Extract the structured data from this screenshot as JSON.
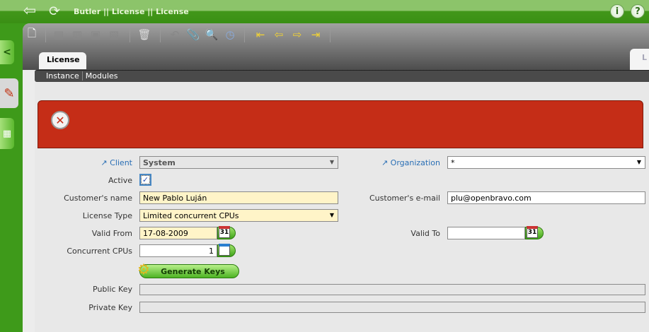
{
  "header": {
    "title": "Butler || License  ||  License",
    "back_icon": "back-arrow-icon",
    "refresh_icon": "refresh-icon",
    "info_label": "i",
    "help_label": "?"
  },
  "side": {
    "collapse_label": "<"
  },
  "toolbar": {
    "tools": [
      "new",
      "copy",
      "save-new",
      "save",
      "save-next",
      "delete",
      "undo",
      "attach",
      "search",
      "audit",
      "first",
      "previous",
      "next",
      "last"
    ]
  },
  "tabs": {
    "active": "License",
    "partial": "L"
  },
  "subtabs": [
    "Instance",
    "Modules"
  ],
  "message": {
    "icon_label": "✕",
    "text": ""
  },
  "form": {
    "client_label": "Client",
    "client_value": "System",
    "org_label": "Organization",
    "org_value": "*",
    "active_label": "Active",
    "active_checked": true,
    "check_mark": "✓",
    "customer_name_label": "Customer's name",
    "customer_name_value": "New Pablo Luján",
    "customer_email_label": "Customer's e-mail",
    "customer_email_value": "plu@openbravo.com",
    "license_type_label": "License Type",
    "license_type_value": "Limited concurrent CPUs",
    "valid_from_label": "Valid From",
    "valid_from_value": "17-08-2009",
    "valid_to_label": "Valid To",
    "valid_to_value": "",
    "cpus_label": "Concurrent CPUs",
    "cpus_value": "1",
    "calendar_day": "31",
    "generate_label": "Generate Keys",
    "public_key_label": "Public Key",
    "public_key_value": "",
    "private_key_label": "Private Key",
    "private_key_value": ""
  }
}
